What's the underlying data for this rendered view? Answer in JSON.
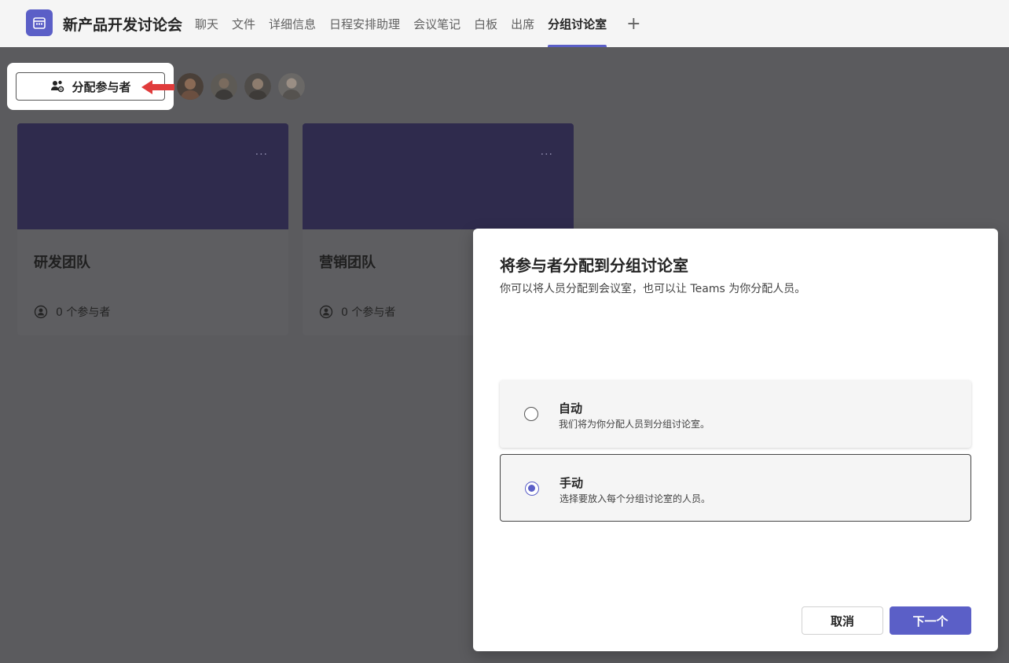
{
  "header": {
    "meeting_title": "新产品开发讨论会",
    "tabs": [
      {
        "label": "聊天"
      },
      {
        "label": "文件"
      },
      {
        "label": "详细信息"
      },
      {
        "label": "日程安排助理"
      },
      {
        "label": "会议笔记"
      },
      {
        "label": "白板"
      },
      {
        "label": "出席"
      },
      {
        "label": "分组讨论室",
        "active": true
      }
    ],
    "add_tab_label": "+"
  },
  "assign": {
    "button_label": "分配参与者"
  },
  "rooms": [
    {
      "name": "研发团队",
      "count_text": "0 个参与者",
      "more": "···"
    },
    {
      "name": "营销团队",
      "count_text": "0 个参与者",
      "more": "···"
    }
  ],
  "dialog": {
    "title": "将参与者分配到分组讨论室",
    "description": "你可以将人员分配到会议室，也可以让 Teams 为你分配人员。",
    "options": [
      {
        "title": "自动",
        "description": "我们将为你分配人员到分组讨论室。",
        "selected": false
      },
      {
        "title": "手动",
        "description": "选择要放入每个分组讨论室的人员。",
        "selected": true
      }
    ],
    "cancel_label": "取消",
    "next_label": "下一个"
  },
  "colors": {
    "accent": "#5b5fc7",
    "room_banner": "#2f2b4d",
    "overlay": "#5b5b5e",
    "arrow": "#e03b3b"
  }
}
